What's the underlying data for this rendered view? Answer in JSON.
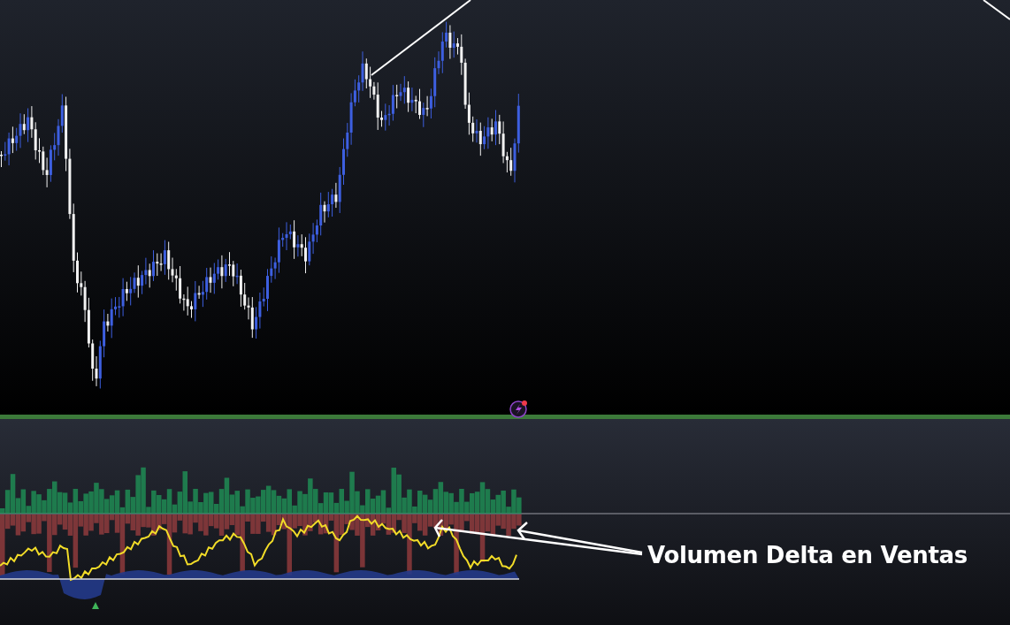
{
  "annotation": {
    "text": "Volumen Delta en Ventas"
  }
}
